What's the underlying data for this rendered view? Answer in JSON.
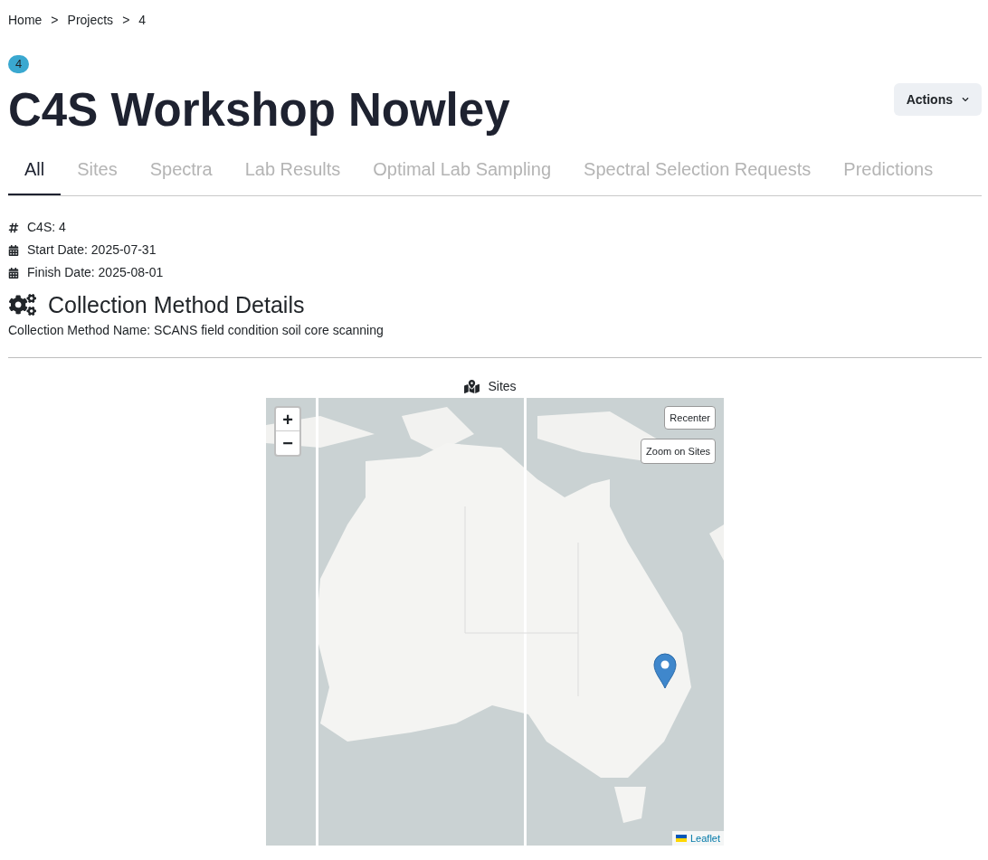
{
  "breadcrumb": {
    "separator": ">",
    "items": [
      "Home",
      "Projects",
      "4"
    ]
  },
  "badge": "4",
  "title": "C4S Workshop Nowley",
  "actions_button": "Actions",
  "tabs": [
    {
      "label": "All",
      "selected": true
    },
    {
      "label": "Sites",
      "selected": false
    },
    {
      "label": "Spectra",
      "selected": false
    },
    {
      "label": "Lab Results",
      "selected": false
    },
    {
      "label": "Optimal Lab Sampling",
      "selected": false
    },
    {
      "label": "Spectral Selection Requests",
      "selected": false
    },
    {
      "label": "Predictions",
      "selected": false
    }
  ],
  "details": [
    {
      "kind": "hash",
      "text": "C4S: 4"
    },
    {
      "kind": "calendar",
      "text": "Start Date: 2025-07-31"
    },
    {
      "kind": "calendar",
      "text": "Finish Date: 2025-08-01"
    }
  ],
  "collection": {
    "heading": "Collection Method Details",
    "name_line": "Collection Method Name: SCANS field condition soil core scanning"
  },
  "map": {
    "title": "Sites",
    "zoom_in": "+",
    "zoom_out": "−",
    "recenter": "Recenter",
    "zoom_on_sites": "Zoom on Sites",
    "attribution": "Leaflet"
  }
}
